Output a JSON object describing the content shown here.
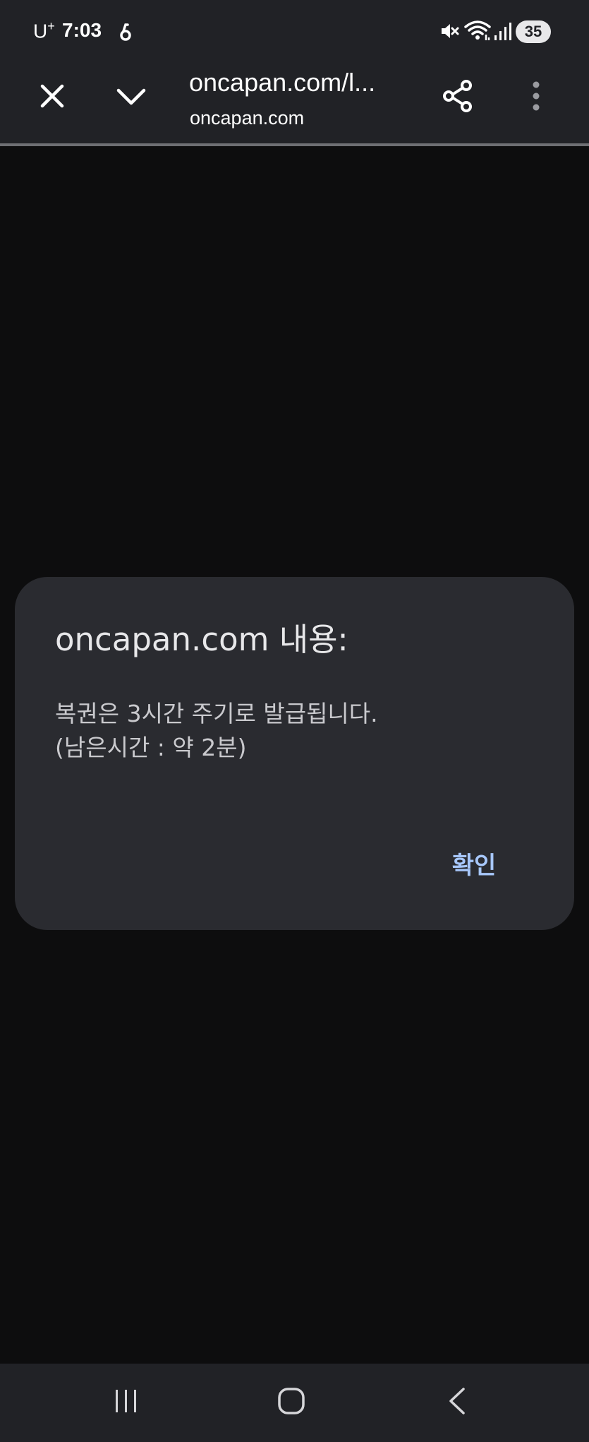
{
  "status_bar": {
    "carrier": "U",
    "carrier_sup": "+",
    "time": "7:03",
    "battery": "35",
    "icons": [
      "notification-icon",
      "mute-icon",
      "wifi-icon",
      "signal-icon"
    ]
  },
  "toolbar": {
    "url_title": "oncapan.com/l...",
    "url_domain": "oncapan.com",
    "icons": [
      "close-icon",
      "chevron-down-icon",
      "share-icon",
      "more-vert-icon"
    ]
  },
  "dialog": {
    "title": "oncapan.com 내용:",
    "message_line1": "복권은 3시간 주기로 발급됩니다.",
    "message_line2": "(남은시간 : 약 2분)",
    "confirm_label": "확인"
  },
  "nav_bar": {
    "icons": [
      "recents-icon",
      "home-icon",
      "back-icon"
    ]
  },
  "colors": {
    "bar_background": "#212226",
    "page_background": "#0d0d0e",
    "dialog_background": "#2a2b30",
    "accent": "#a7c7fa"
  }
}
